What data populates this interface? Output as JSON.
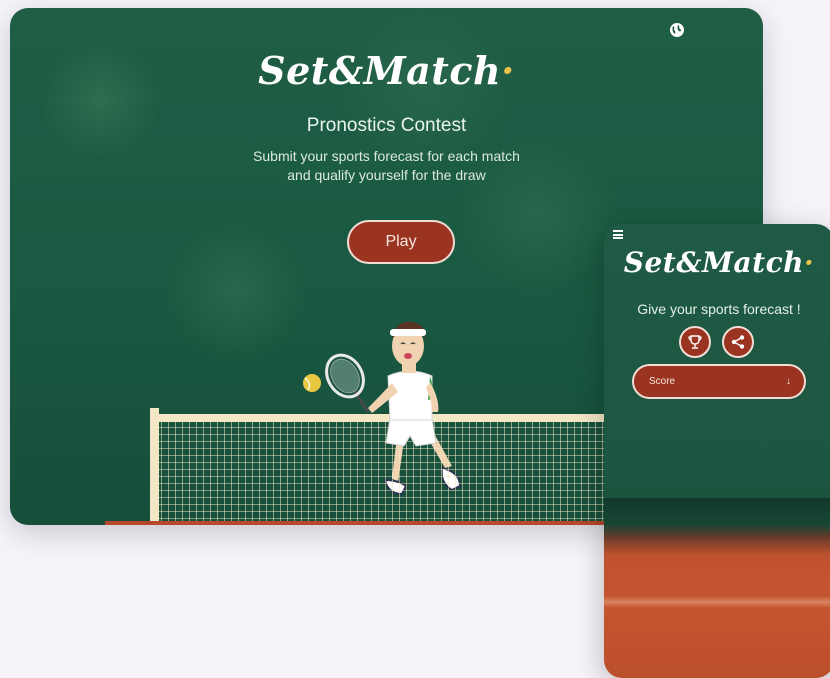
{
  "tablet": {
    "brand_main": "Set&Match",
    "brand_dot": "·",
    "title": "Pronostics Contest",
    "subtitle_line1": "Submit your sports forecast for each match",
    "subtitle_line2": "and qualify yourself for the draw",
    "play_label": "Play",
    "language_icon": "globe-icon"
  },
  "phone": {
    "menu_icon": "hamburger-menu-icon",
    "brand_main": "Set&Match",
    "brand_dot": "·",
    "tagline": "Give your sports forecast !",
    "buttons": [
      {
        "icon": "trophy-icon"
      },
      {
        "icon": "share-icon"
      }
    ],
    "select_label": "Score",
    "select_icon": "arrow-down-icon"
  },
  "colors": {
    "court_green": "#1d5a43",
    "button_clay": "#9a3420",
    "button_border": "#f2ddd6",
    "brand_dot": "#e8c44a",
    "clay_court": "#c5552f"
  }
}
